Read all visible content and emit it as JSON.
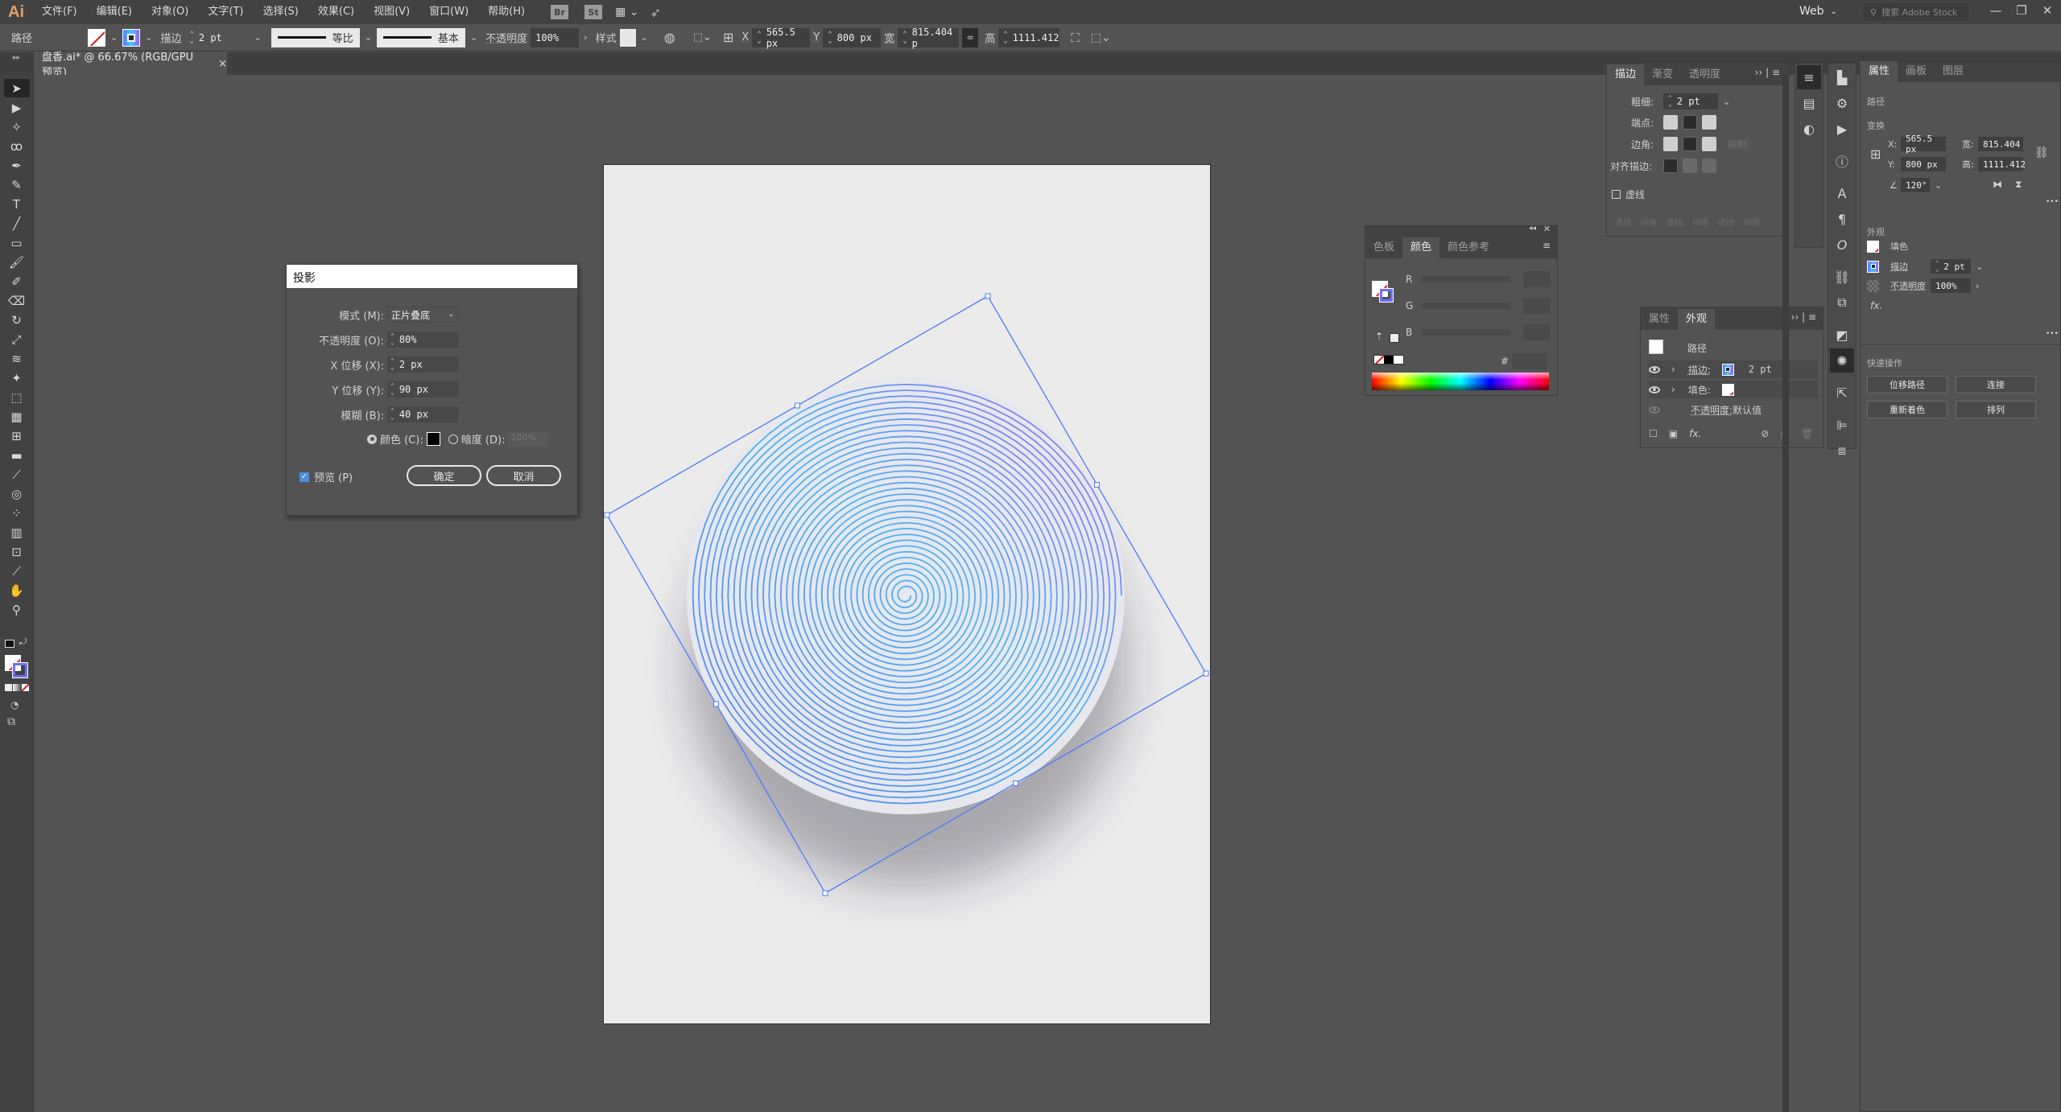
{
  "app": {
    "logo": "Ai",
    "menus": [
      "文件(F)",
      "编辑(E)",
      "对象(O)",
      "文字(T)",
      "选择(S)",
      "效果(C)",
      "视图(V)",
      "窗口(W)",
      "帮助(H)"
    ],
    "bridge_label": "Br",
    "stock_label": "St",
    "workspace": "Web",
    "search_placeholder": "搜索 Adobe Stock",
    "window_controls": {
      "minimize": "—",
      "restore": "❐",
      "close": "✕"
    }
  },
  "control_bar": {
    "object_type": "路径",
    "stroke_label": "描边",
    "stroke_weight": "2 pt",
    "profile_1_label": "等比",
    "profile_2_label": "基本",
    "opacity_label": "不透明度",
    "opacity_value": "100%",
    "style_label": "样式",
    "x_label": "X",
    "x_value": "565.5 px",
    "y_label": "Y",
    "y_value": "800 px",
    "w_label": "宽",
    "w_value": "815.404 p",
    "h_label": "高",
    "h_value": "1111.412"
  },
  "document_tab": {
    "title": "盘香.ai* @ 66.67% (RGB/GPU 预览)",
    "close": "×"
  },
  "tools": [
    {
      "name": "selection-tool",
      "glyph": "➤",
      "selected": true
    },
    {
      "name": "direct-selection-tool",
      "glyph": "▶"
    },
    {
      "name": "magic-wand-tool",
      "glyph": "✧"
    },
    {
      "name": "lasso-tool",
      "glyph": "ꝏ"
    },
    {
      "name": "pen-tool",
      "glyph": "✒"
    },
    {
      "name": "curvature-tool",
      "glyph": "✎"
    },
    {
      "name": "type-tool",
      "glyph": "T"
    },
    {
      "name": "line-tool",
      "glyph": "╱"
    },
    {
      "name": "rectangle-tool",
      "glyph": "▭"
    },
    {
      "name": "paintbrush-tool",
      "glyph": "🖌"
    },
    {
      "name": "shaper-tool",
      "glyph": "✐"
    },
    {
      "name": "eraser-tool",
      "glyph": "⌫"
    },
    {
      "name": "rotate-tool",
      "glyph": "↻"
    },
    {
      "name": "scale-tool",
      "glyph": "⤢"
    },
    {
      "name": "warp-tool",
      "glyph": "≋"
    },
    {
      "name": "puppet-warp-tool",
      "glyph": "✦"
    },
    {
      "name": "free-transform-tool",
      "glyph": "⬚"
    },
    {
      "name": "perspective-grid-tool",
      "glyph": "▦"
    },
    {
      "name": "mesh-tool",
      "glyph": "⊞"
    },
    {
      "name": "gradient-tool",
      "glyph": "▬"
    },
    {
      "name": "eyedropper-tool",
      "glyph": "⟋"
    },
    {
      "name": "blend-tool",
      "glyph": "◎"
    },
    {
      "name": "symbol-sprayer-tool",
      "glyph": "⁘"
    },
    {
      "name": "column-graph-tool",
      "glyph": "▥"
    },
    {
      "name": "artboard-tool",
      "glyph": "⊡"
    },
    {
      "name": "slice-tool",
      "glyph": "⟋"
    },
    {
      "name": "hand-tool",
      "glyph": "✋"
    },
    {
      "name": "zoom-tool",
      "glyph": "⚲"
    }
  ],
  "drop_shadow_dialog": {
    "title": "投影",
    "mode_label": "模式 (M):",
    "mode_value": "正片叠底",
    "opacity_label": "不透明度 (O):",
    "opacity_value": "80%",
    "x_offset_label": "X 位移 (X):",
    "x_offset_value": "2 px",
    "y_offset_label": "Y 位移 (Y):",
    "y_offset_value": "90 px",
    "blur_label": "模糊 (B):",
    "blur_value": "40 px",
    "color_label": "颜色 (C):",
    "color_value": "#000000",
    "color_selected": true,
    "darkness_label": "暗度 (D):",
    "darkness_value": "100%",
    "preview_label": "预览 (P)",
    "preview_checked": true,
    "ok_label": "确定",
    "cancel_label": "取消"
  },
  "stroke_panel": {
    "tabs": [
      "描边",
      "渐变",
      "透明度"
    ],
    "active_tab": "描边",
    "weight_label": "粗细:",
    "weight_value": "2 pt",
    "cap_label": "端点:",
    "corner_label": "边角:",
    "limit_label": "限制:",
    "align_label": "对齐描边:",
    "dashed_label": "虚线",
    "dashed_checked": false,
    "dash_fields": [
      "虚线",
      "间隙",
      "虚线",
      "间隙",
      "虚线",
      "间隙"
    ]
  },
  "color_panel": {
    "tabs": [
      "色板",
      "颜色",
      "颜色参考"
    ],
    "active_tab": "颜色",
    "channels": [
      "R",
      "G",
      "B"
    ],
    "hex_label": "#"
  },
  "appearance_panel": {
    "tabs": [
      "属性",
      "外观"
    ],
    "active_tab": "外观",
    "object_label": "路径",
    "rows": [
      {
        "label": "描边:",
        "value": "2 pt",
        "swatch": "gradient"
      },
      {
        "label": "填色:",
        "value": "",
        "swatch": "none"
      },
      {
        "label": "不透明度:",
        "value": "默认值",
        "swatch": ""
      }
    ]
  },
  "properties_panel": {
    "tabs": [
      "属性",
      "画板",
      "图层"
    ],
    "active_tab": "属性",
    "object_type": "路径",
    "transform_heading": "变换",
    "x_label": "X:",
    "x_value": "565.5 px",
    "y_label": "Y:",
    "y_value": "800 px",
    "w_label": "宽:",
    "w_value": "815.404",
    "h_label": "高:",
    "h_value": "1111.412",
    "angle_value": "120°",
    "appearance_heading": "外观",
    "fill_label": "填色",
    "stroke_label": "描边",
    "stroke_value": "2 pt",
    "opacity_label": "不透明度",
    "opacity_value": "100%",
    "fx_label": "fx.",
    "more": "•••",
    "quick_actions_heading": "快速操作",
    "quick_actions": [
      "位移路径",
      "连接",
      "重新着色",
      "排列"
    ]
  },
  "artwork": {
    "stroke_gradient": [
      "#5b7cf0",
      "#4fb3f5",
      "#9a6af2"
    ],
    "selection_color": "#4a7cf7",
    "spiral_turns": 36
  }
}
